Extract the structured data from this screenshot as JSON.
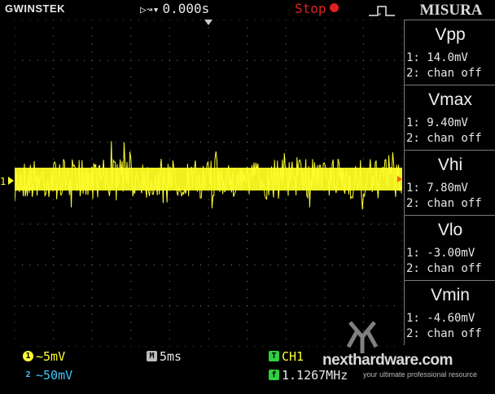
{
  "header": {
    "brand": "GWINSTEK",
    "trigger_offset": "0.000s",
    "run_state": "Stop",
    "menu_title": "MISURA"
  },
  "channel1_marker": "1",
  "measurements": [
    {
      "name": "Vpp",
      "ch1": "1: 14.0mV",
      "ch2": "2: chan off"
    },
    {
      "name": "Vmax",
      "ch1": "1: 9.40mV",
      "ch2": "2: chan off"
    },
    {
      "name": "Vhi",
      "ch1": "1: 7.80mV",
      "ch2": "2: chan off"
    },
    {
      "name": "Vlo",
      "ch1": "1: -3.00mV",
      "ch2": "2: chan off"
    },
    {
      "name": "Vmin",
      "ch1": "1: -4.60mV",
      "ch2": "2: chan off"
    }
  ],
  "status": {
    "ch1_badge": "1",
    "ch1_scale": "~5mV",
    "ch2_badge": "2",
    "ch2_scale": "~50mV",
    "time_badge": "M",
    "timebase": "5ms",
    "trigger_badge": "T",
    "trigger_source": "CH1",
    "freq_badge": "f",
    "frequency": "1.1267MHz"
  },
  "watermark": {
    "site": "nexthardware.com",
    "tagline": "your ultimate professional resource"
  },
  "colors": {
    "ch1": "#ffff30",
    "ch2": "#40c8ff",
    "stop": "#e02020",
    "trigger": "#30d040"
  }
}
